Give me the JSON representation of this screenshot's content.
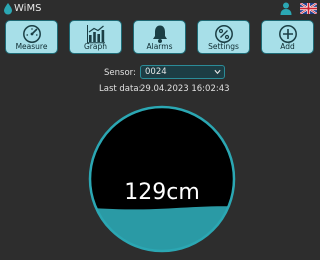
{
  "app": {
    "title": "WiMS"
  },
  "header": {
    "user_icon": "user-icon",
    "language_icon": "uk-flag-icon"
  },
  "toolbar": {
    "buttons": [
      {
        "label": "Measure",
        "icon": "gauge-icon"
      },
      {
        "label": "Graph",
        "icon": "bar-chart-icon"
      },
      {
        "label": "Alarms",
        "icon": "bell-icon"
      },
      {
        "label": "Settings",
        "icon": "percent-dial-icon"
      },
      {
        "label": "Add",
        "icon": "plus-circle-icon"
      }
    ]
  },
  "sensor": {
    "label": "Sensor:",
    "selected": "0024"
  },
  "last_data": {
    "label": "Last data:",
    "value": "29.04.2023 16:02:43"
  },
  "gauge": {
    "level_text": "129cm",
    "fill_fraction": 0.3
  },
  "colors": {
    "background": "#2d2d2d",
    "accent": "#2ba7b3",
    "button_bg": "#a7dfe8",
    "liquid": "#2a9aa5"
  }
}
